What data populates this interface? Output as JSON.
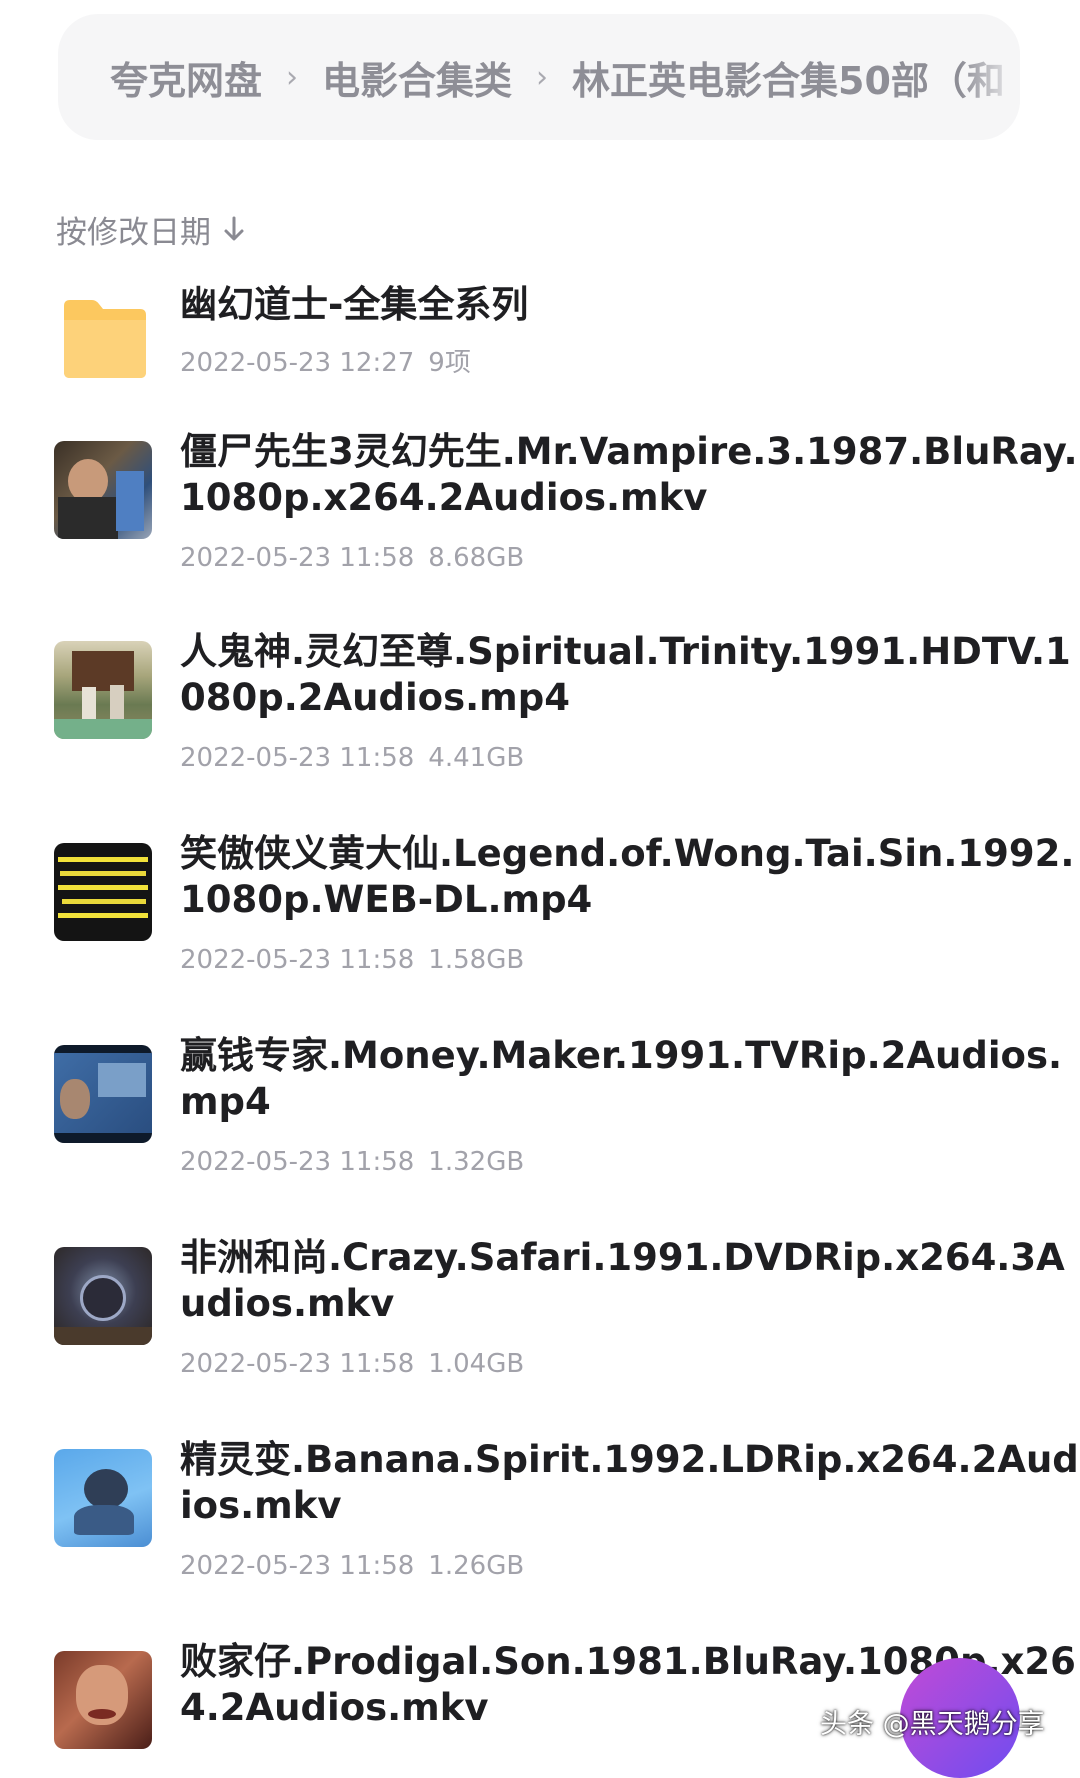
{
  "breadcrumb": {
    "items": [
      "夸克网盘",
      "电影合集类",
      "林正英电影合集50部（和"
    ],
    "separator": "›"
  },
  "sort": {
    "label": "按修改日期",
    "direction_icon": "arrow-down-icon"
  },
  "files": [
    {
      "kind": "folder",
      "name": "幽幻道士-全集全系列",
      "date": "2022-05-23 12:27",
      "size": "9项"
    },
    {
      "kind": "video",
      "name": "僵尸先生3灵幻先生.Mr.Vampire.3.1987.BluRay.1080p.x264.2Audios.mkv",
      "date": "2022-05-23 11:58",
      "size": "8.68GB"
    },
    {
      "kind": "video",
      "name": "人鬼神.灵幻至尊.Spiritual.Trinity.1991.HDTV.1080p.2Audios.mp4",
      "date": "2022-05-23 11:58",
      "size": "4.41GB"
    },
    {
      "kind": "video",
      "name": "笑傲侠义黄大仙.Legend.of.Wong.Tai.Sin.1992.1080p.WEB-DL.mp4",
      "date": "2022-05-23 11:58",
      "size": "1.58GB"
    },
    {
      "kind": "video",
      "name": "赢钱专家.Money.Maker.1991.TVRip.2Audios.mp4",
      "date": "2022-05-23 11:58",
      "size": "1.32GB"
    },
    {
      "kind": "video",
      "name": "非洲和尚.Crazy.Safari.1991.DVDRip.x264.3Audios.mkv",
      "date": "2022-05-23 11:58",
      "size": "1.04GB"
    },
    {
      "kind": "video",
      "name": "精灵变.Banana.Spirit.1992.LDRip.x264.2Audios.mkv",
      "date": "2022-05-23 11:58",
      "size": "1.26GB"
    },
    {
      "kind": "video",
      "name": "败家仔.Prodigal.Son.1981.BluRay.1080p.x264.2Audios.mkv",
      "date": "",
      "size": ""
    }
  ],
  "watermark": "头条 @黑天鹅分享",
  "colors": {
    "folder": "#fcc85f",
    "breadcrumb_bg": "#f6f6f7",
    "meta_text": "#a2a2aa",
    "fab_gradient_start": "#c14bd6",
    "fab_gradient_end": "#6f4cf0"
  }
}
